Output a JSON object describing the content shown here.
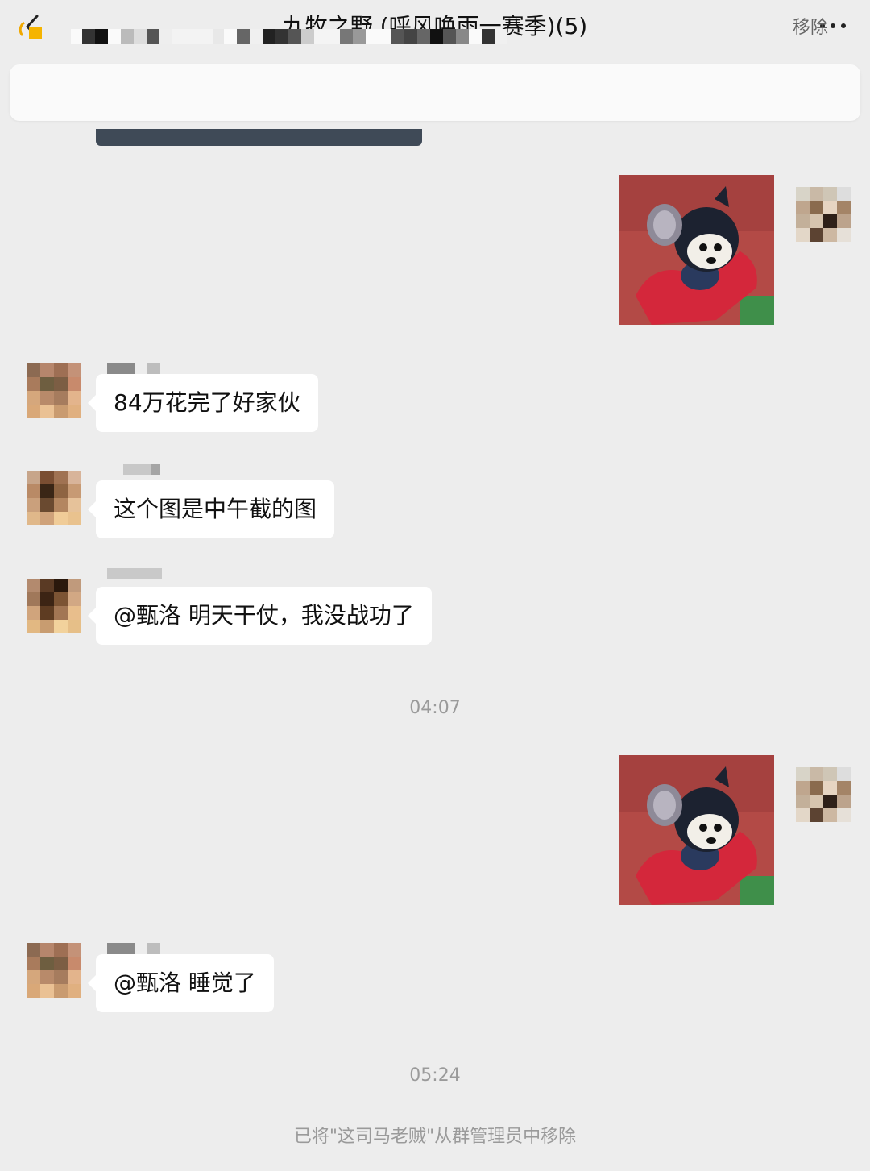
{
  "header": {
    "title": "九牧之野 (呼风唤雨一赛季)(5)",
    "back_icon": "chevron-left-icon",
    "more_icon": "ellipsis-icon"
  },
  "pinned": {
    "icon": "pinned-notice-icon",
    "remove_label": "移除"
  },
  "messages": [
    {
      "side": "right",
      "type": "sticker"
    },
    {
      "side": "left",
      "type": "text",
      "text": "84万花完了好家伙"
    },
    {
      "side": "left",
      "type": "text",
      "text": "这个图是中午截的图"
    },
    {
      "side": "left",
      "type": "text",
      "text": "@甄洛 明天干仗，我没战功了"
    },
    {
      "type": "time",
      "text": "04:07"
    },
    {
      "side": "right",
      "type": "sticker"
    },
    {
      "side": "left",
      "type": "text",
      "text": "@甄洛 睡觉了"
    },
    {
      "type": "time",
      "text": "05:24"
    },
    {
      "type": "system",
      "text": "已将\"这司马老贼\"从群管理员中移除"
    }
  ],
  "colors": {
    "background": "#ededed",
    "bubble": "#ffffff",
    "timestamp": "#9a9a9a"
  }
}
